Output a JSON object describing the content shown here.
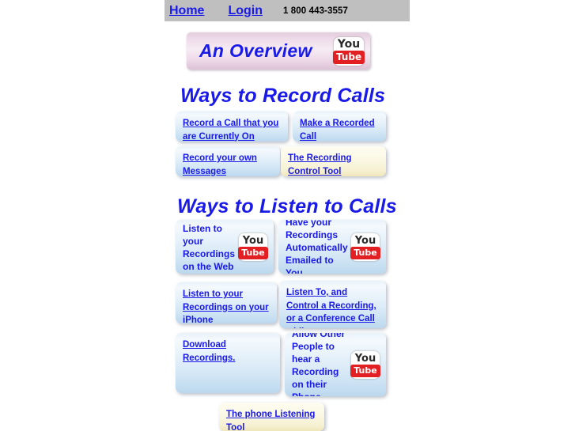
{
  "nav": {
    "home": "Home",
    "login": "Login",
    "phone": "1 800 443-3557"
  },
  "banner": {
    "title": "An Overview",
    "icon": "youtube-icon"
  },
  "youtube_icon": {
    "top_text": "You",
    "bottom_text": "Tube"
  },
  "sections": [
    {
      "heading": "Ways to Record Calls",
      "cards": [
        {
          "label": "Record a Call that you are Currently On",
          "style": "blue",
          "underlined": true,
          "icon": null
        },
        {
          "label": "Make a Recorded Call",
          "style": "blue",
          "underlined": true,
          "icon": null
        },
        {
          "label": "Record your own Messages",
          "style": "blue",
          "underlined": true,
          "icon": null
        },
        {
          "label": "The Recording Control Tool",
          "style": "cream",
          "underlined": true,
          "icon": null
        }
      ]
    },
    {
      "heading": "Ways to Listen to Calls",
      "cards": [
        {
          "label": "Listen to your Recordings on the Web",
          "style": "blue",
          "underlined": false,
          "icon": "youtube-icon"
        },
        {
          "label": "Have your Recordings Automatically Emailed to You",
          "style": "blue",
          "underlined": false,
          "icon": "youtube-icon"
        },
        {
          "label": "Listen to your Recordings on your iPhone",
          "style": "blue",
          "underlined": true,
          "icon": null
        },
        {
          "label": " Listen To, and Control a Recording, or a Conference Call while you are on a Call",
          "style": "blue",
          "underlined": true,
          "icon": null
        },
        {
          "label": "Download Recordings.",
          "style": "blue",
          "underlined": true,
          "icon": null
        },
        {
          "label": "Allow Other People to hear a Recording on their Phone",
          "style": "blue",
          "underlined": false,
          "icon": "youtube-icon"
        },
        {
          "label": "The phone Listening Tool",
          "style": "cream",
          "underlined": true,
          "icon": null
        }
      ]
    }
  ],
  "colors": {
    "link_blue": "#1a1ae8",
    "navbar_gray": "#bfbfbf",
    "card_blue": "#e2eff9",
    "card_cream": "#fbf9e6",
    "youtube_red": "#e21f22",
    "banner_pink": "#eedbe9"
  }
}
